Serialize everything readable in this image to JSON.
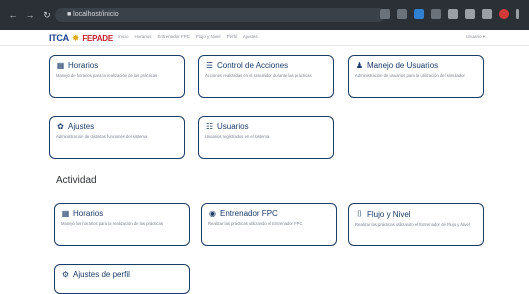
{
  "browser": {
    "url": "■ localhost/inicio",
    "nav_icons": [
      "back-arrow",
      "forward-arrow",
      "reload",
      "home"
    ]
  },
  "header": {
    "brand_left": "ITCA",
    "brand_right": "FEPADE",
    "menu": [
      "Inicio",
      "Horarios",
      "Entrenador FPC",
      "Flujo y Nivel",
      "Perfil",
      "Ajustes"
    ],
    "user": "Usuario ▾"
  },
  "admin_cards": [
    {
      "title": "Horarios",
      "icon": "calendar-icon",
      "desc": "Manejo de horarios para la realización de las prácticas"
    },
    {
      "title": "Control de Acciones",
      "icon": "list-icon",
      "desc": "Acciones realizadas en el simulador durante las prácticas"
    },
    {
      "title": "Manejo de Usuarios",
      "icon": "user-icon",
      "desc": "Administración de usuarios para la utilización del simulador"
    },
    {
      "title": "Ajustes",
      "icon": "gear-icon",
      "desc": "Administración de distintas funciones del sistema"
    },
    {
      "title": "Usuarios",
      "icon": "users-icon",
      "desc": "Usuarios registrados en el sistema"
    }
  ],
  "section": {
    "title": "Actividad"
  },
  "activity_cards": [
    {
      "title": "Horarios",
      "icon": "calendar-icon",
      "desc": "Manejo los horarios para la realización de las prácticas"
    },
    {
      "title": "Entrenador FPC",
      "icon": "gamepad-icon",
      "desc": "Realizar las prácticas utilizando el Entrenador FPC"
    },
    {
      "title": "Flujo y Nivel",
      "icon": "tank-icon",
      "desc": "Realizar las prácticas utilizando el Entrenador de Flujo y Nivel"
    },
    {
      "title": "Ajustes de perfil",
      "icon": "settings-icon",
      "desc": ""
    }
  ],
  "colors": {
    "accent": "#1c3b67",
    "chrome": "#2b3036",
    "brand_blue": "#1b3f8f",
    "brand_red": "#c81f2b"
  }
}
